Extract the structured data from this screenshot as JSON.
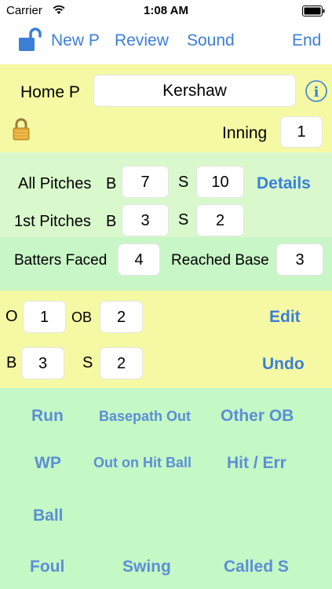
{
  "status": {
    "carrier": "Carrier",
    "time": "1:08 AM"
  },
  "nav": {
    "new_p": "New P",
    "review": "Review",
    "sound": "Sound",
    "end": "End"
  },
  "pitcher": {
    "label": "Home P",
    "name": "Kershaw",
    "inning_label": "Inning",
    "inning": "1"
  },
  "pitches": {
    "all_label": "All Pitches",
    "b_label": "B",
    "s_label": "S",
    "all_b": "7",
    "all_s": "10",
    "details": "Details",
    "first_label": "1st Pitches",
    "first_b": "3",
    "first_s": "2"
  },
  "batters": {
    "faced_label": "Batters Faced",
    "faced": "4",
    "reached_label": "Reached Base",
    "reached": "3"
  },
  "count": {
    "o_label": "O",
    "o": "1",
    "ob_label": "OB",
    "ob": "2",
    "edit": "Edit",
    "b_label": "B",
    "b": "3",
    "s_label": "S",
    "s": "2",
    "undo": "Undo"
  },
  "actions": {
    "run": "Run",
    "basepath_out": "Basepath Out",
    "other_ob": "Other OB",
    "wp": "WP",
    "out_on_hit_ball": "Out on Hit Ball",
    "hit_err": "Hit / Err",
    "ball": "Ball",
    "foul": "Foul",
    "swing": "Swing",
    "called_s": "Called S"
  },
  "colors": {
    "accent": "#3b7fd6",
    "yellow_bg": "#f6f9a4",
    "green_bg": "#c4f8c5"
  }
}
